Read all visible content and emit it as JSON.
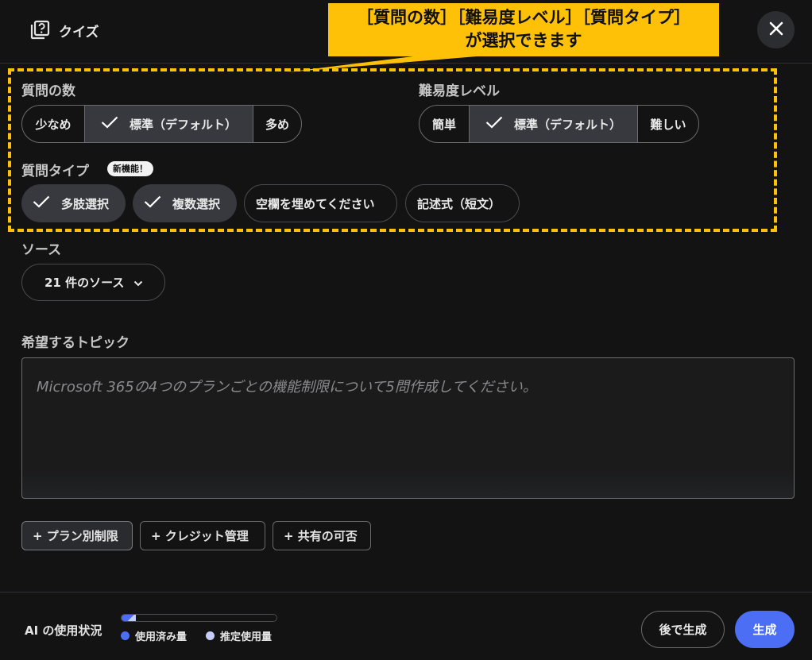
{
  "header": {
    "title": "クイズ",
    "icon": "quiz-icon",
    "close_icon": "close-icon"
  },
  "annotation": {
    "line1": "［質問の数］［難易度レベル］［質問タイプ］",
    "line2": "が選択できます",
    "color": "#ffc107"
  },
  "question_count": {
    "label": "質問の数",
    "options": [
      "少なめ",
      "標準（デフォルト）",
      "多め"
    ],
    "selected": "標準（デフォルト）"
  },
  "difficulty": {
    "label": "難易度レベル",
    "options": [
      "簡単",
      "標準（デフォルト）",
      "難しい"
    ],
    "selected": "標準（デフォルト）"
  },
  "question_type": {
    "label": "質問タイプ",
    "badge": "新機能！",
    "options": [
      {
        "label": "多肢選択",
        "selected": true
      },
      {
        "label": "複数選択",
        "selected": true
      },
      {
        "label": "空欄を埋めてください",
        "selected": false
      },
      {
        "label": "記述式（短文）",
        "selected": false
      }
    ]
  },
  "source": {
    "label": "ソース",
    "button": "21 件のソース"
  },
  "topic": {
    "label": "希望するトピック",
    "placeholder": "Microsoft 365の4つのプランごとの機能制限について5問作成してください。"
  },
  "suggestions": [
    "+ プラン別制限",
    "+ クレジット管理",
    "+ 共有の可否"
  ],
  "footer": {
    "ai_usage_label": "AI の使用状況",
    "usage_fraction": 0.09,
    "legend_used": "使用済み量",
    "legend_estimated": "推定使用量",
    "used_color": "#4c6ef5",
    "estimated_color": "#c5cdf7",
    "later_button": "後で生成",
    "generate_button": "生成"
  }
}
